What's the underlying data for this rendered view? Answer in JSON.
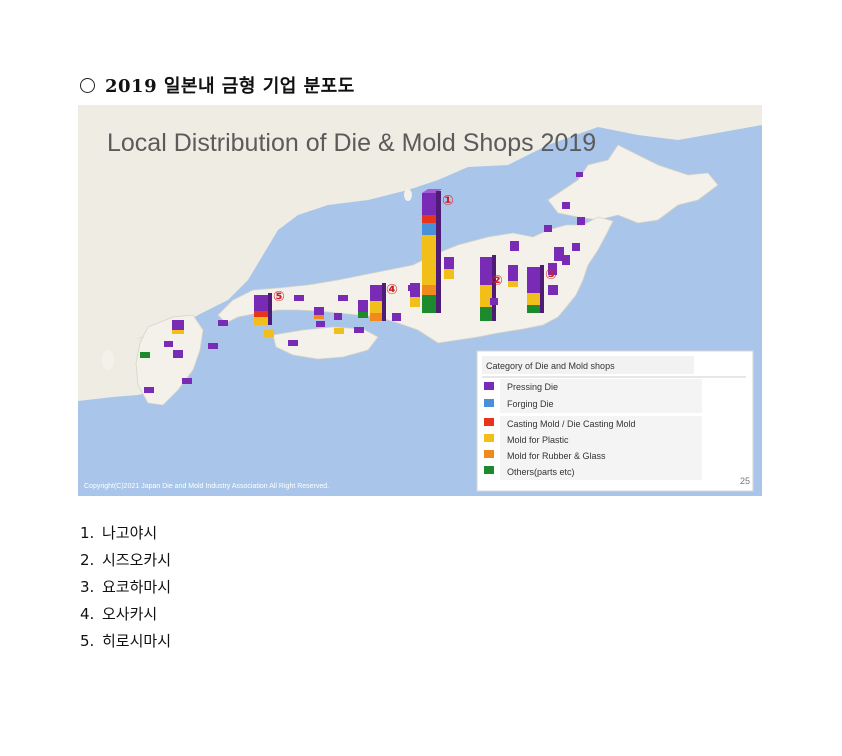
{
  "heading": {
    "text": "2019 일본내 금형 기업 분포도"
  },
  "figure": {
    "title": "Local Distribution of Die & Mold Shops 2019",
    "copyright": "Copyright(C)2021 Japan Die and Mold Industry Association All Right Reserved.",
    "page_number": "25",
    "legend": {
      "title": "Category of Die and Mold shops",
      "items": [
        {
          "label": "Pressing Die",
          "color": "#7a2bb5"
        },
        {
          "label": "Forging Die",
          "color": "#4a90d9"
        },
        {
          "label": "Casting Mold / Die Casting Mold",
          "color": "#e8341c"
        },
        {
          "label": "Mold for Plastic",
          "color": "#f2be1a"
        },
        {
          "label": "Mold for Rubber & Glass",
          "color": "#f08a1c"
        },
        {
          "label": "Others(parts etc)",
          "color": "#1e8a2e"
        }
      ]
    },
    "markers": [
      "①",
      "②",
      "③",
      "④",
      "⑤"
    ]
  },
  "list": [
    {
      "num": "1.",
      "text": "나고야시"
    },
    {
      "num": "2.",
      "text": "시즈오카시"
    },
    {
      "num": "3.",
      "text": "요코하마시"
    },
    {
      "num": "4.",
      "text": "오사카시"
    },
    {
      "num": "5.",
      "text": "히로시마시"
    }
  ]
}
